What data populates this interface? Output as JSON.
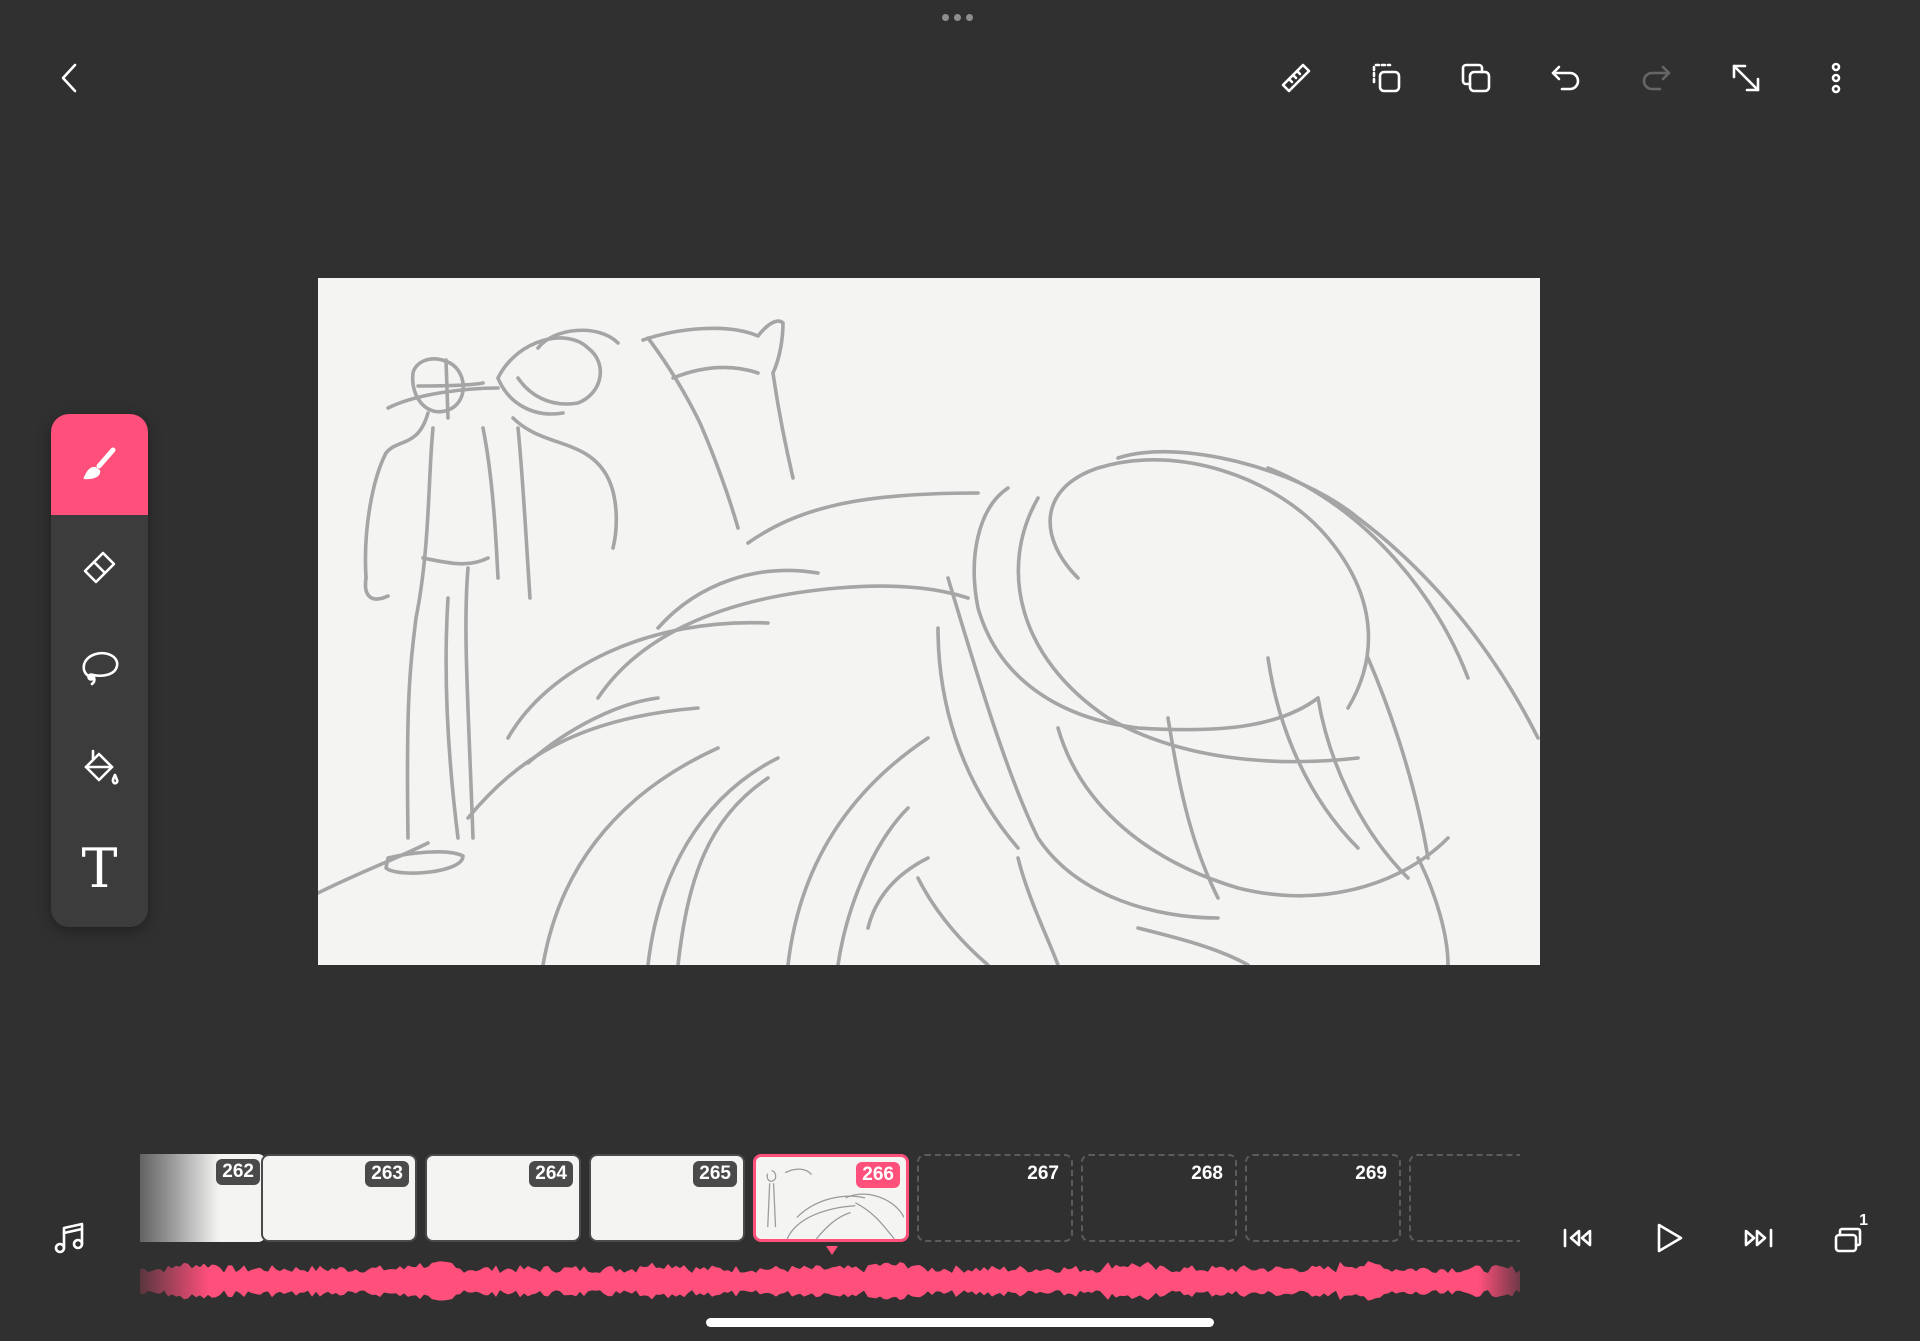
{
  "toolbar": {
    "icons": [
      "back-icon",
      "ruler-icon",
      "duplicate-frame-icon",
      "copy-icon",
      "undo-icon",
      "redo-icon",
      "resize-icon",
      "more-icon"
    ]
  },
  "tools": {
    "items": [
      {
        "name": "brush",
        "active": true
      },
      {
        "name": "eraser",
        "active": false
      },
      {
        "name": "lasso",
        "active": false
      },
      {
        "name": "fill",
        "active": false
      },
      {
        "name": "text",
        "active": false,
        "glyph": "T"
      }
    ]
  },
  "timeline": {
    "frames": [
      {
        "number": "262",
        "state": "filled"
      },
      {
        "number": "263",
        "state": "filled"
      },
      {
        "number": "264",
        "state": "filled"
      },
      {
        "number": "265",
        "state": "filled"
      },
      {
        "number": "266",
        "state": "current"
      },
      {
        "number": "267",
        "state": "empty"
      },
      {
        "number": "268",
        "state": "empty"
      },
      {
        "number": "269",
        "state": "empty"
      },
      {
        "number": "",
        "state": "empty"
      }
    ],
    "current_frame": "266"
  },
  "playback": {
    "icons": [
      "music-icon",
      "skip-to-start-icon",
      "play-icon",
      "skip-to-end-icon",
      "onion-skin-icon"
    ],
    "onion_skin_count": "1"
  },
  "colors": {
    "accent": "#ff4f7b",
    "background": "#303030",
    "canvas": "#f4f4f3",
    "stroke": "#a5a5a5"
  }
}
